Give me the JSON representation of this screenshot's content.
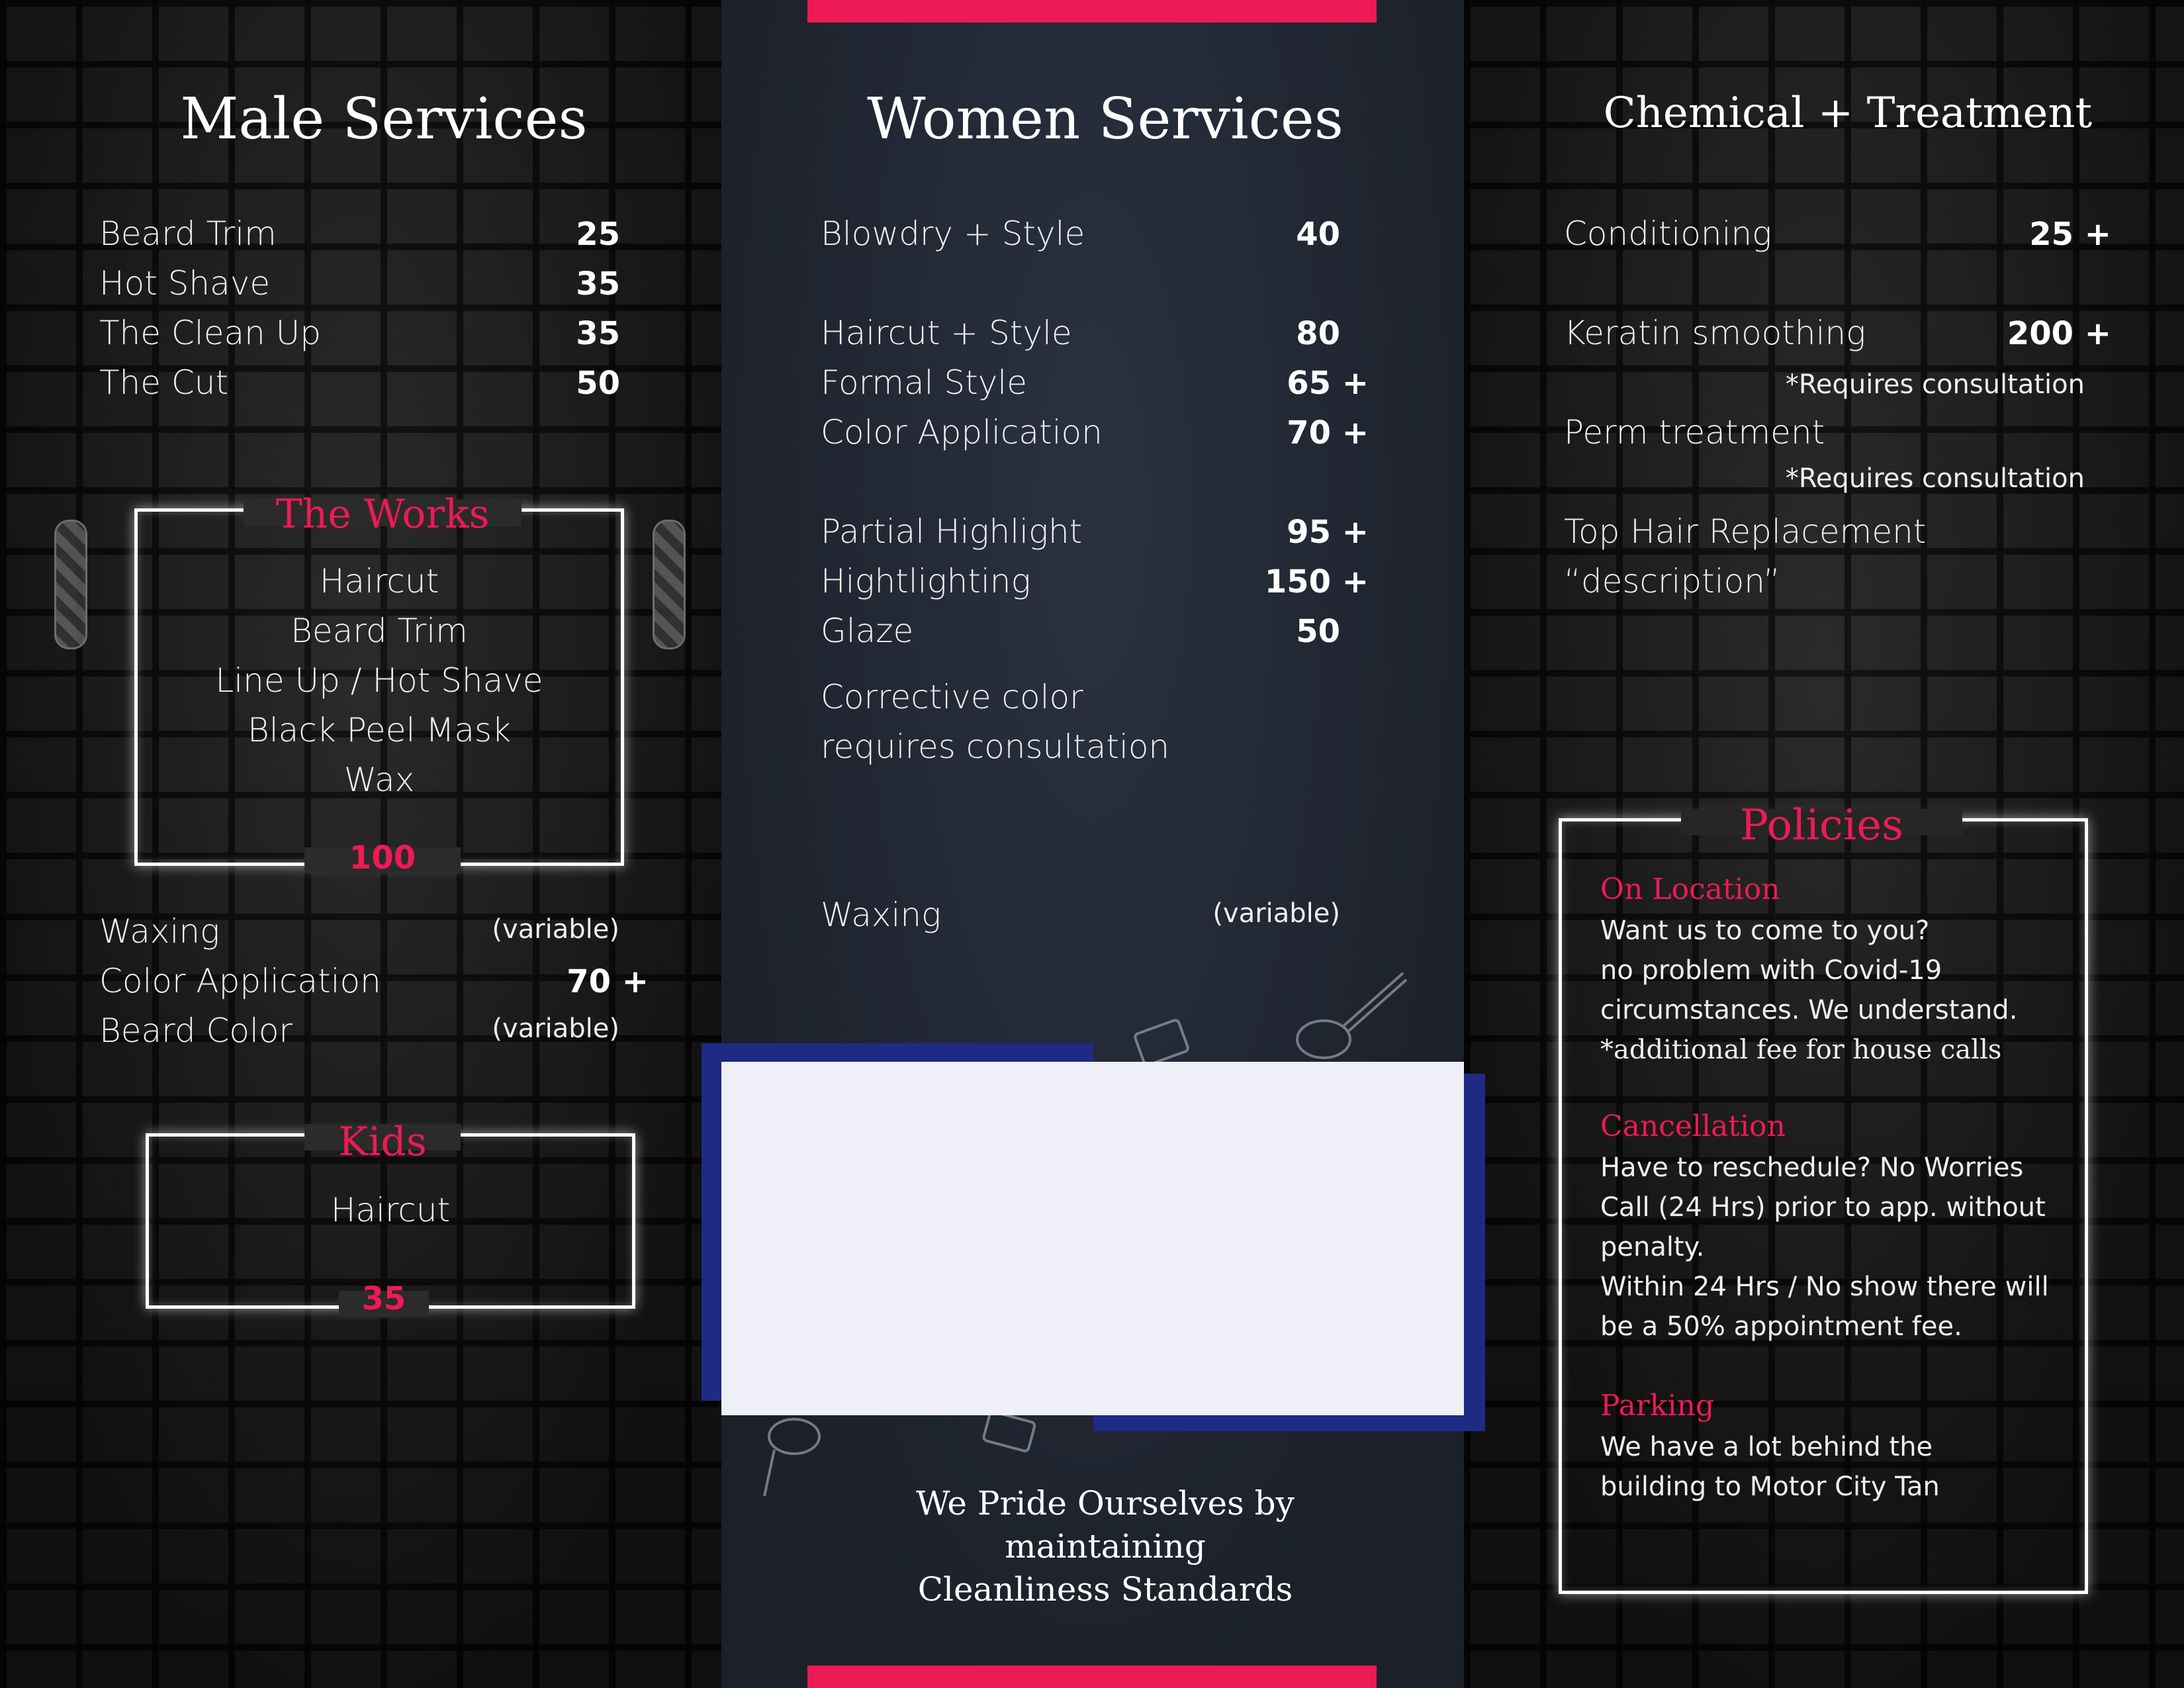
{
  "male": {
    "title": "Male Services",
    "items": [
      {
        "name": "Beard Trim",
        "price": "25"
      },
      {
        "name": "Hot Shave",
        "price": "35"
      },
      {
        "name": "The Clean Up",
        "price": "35"
      },
      {
        "name": "The Cut",
        "price": "50"
      }
    ],
    "works": {
      "title": "The Works",
      "items": [
        "Haircut",
        "Beard Trim",
        "Line Up / Hot Shave",
        "Black Peel Mask",
        "Wax"
      ],
      "price": "100"
    },
    "extras": [
      {
        "name": "Waxing",
        "price": "(variable)"
      },
      {
        "name": "Color Application",
        "price": "70 +"
      },
      {
        "name": "Beard Color",
        "price": "(variable)"
      }
    ],
    "kids": {
      "title": "Kids",
      "item": "Haircut",
      "price": "35"
    }
  },
  "women": {
    "title": "Women Services",
    "items": [
      {
        "name": "Blowdry + Style",
        "price": "40"
      },
      {
        "name": "Haircut + Style",
        "price": "80"
      },
      {
        "name": "Formal Style",
        "price": "65 +"
      },
      {
        "name": "Color Application",
        "price": "70 +"
      },
      {
        "name": "Partial Highlight",
        "price": "95 +"
      },
      {
        "name": "Hightlighting",
        "price": "150 +"
      },
      {
        "name": "Glaze",
        "price": "50"
      }
    ],
    "corrective": [
      "Corrective color",
      "requires consultation"
    ],
    "waxing": {
      "name": "Waxing",
      "price": "(variable)"
    },
    "pride": [
      "We Pride Ourselves by",
      "maintaining",
      "Cleanliness Standards"
    ]
  },
  "chemical": {
    "title": "Chemical + Treatment",
    "items": [
      {
        "name": "Conditioning",
        "price": "25 +"
      },
      {
        "name": "Keratin smoothing",
        "price": "200 +",
        "note": "*Requires consultation"
      },
      {
        "name": "Perm treatment",
        "note": "*Requires consultation"
      },
      {
        "name": "Top Hair Replacement",
        "desc": "“description”"
      }
    ]
  },
  "policies": {
    "title": "Policies",
    "sections": [
      {
        "heading": "On Location",
        "lines": [
          "Want us to come to you?",
          "no problem with Covid-19",
          "circumstances. We understand.",
          "*additional fee for house calls"
        ]
      },
      {
        "heading": "Cancellation",
        "lines": [
          "Have to reschedule? No Worries",
          "Call (24 Hrs) prior to app. without",
          "penalty.",
          "Within 24 Hrs / No show there will",
          "be a 50% appointment fee."
        ]
      },
      {
        "heading": "Parking",
        "lines": [
          "We have a lot behind the",
          "building to Motor City Tan"
        ]
      }
    ]
  },
  "colors": {
    "accent": "#ee1a55",
    "navy": "#1f2a85",
    "panel": "#1e2430",
    "photo_placeholder": "#eeeff7"
  }
}
